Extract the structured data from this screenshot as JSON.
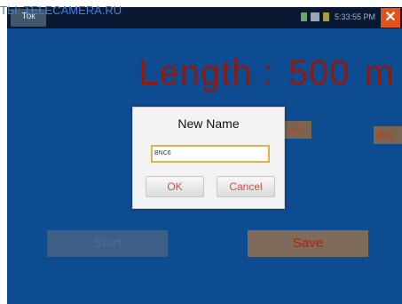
{
  "watermark": "ТЫ: TELECAMERA.RU",
  "topbar": {
    "back_label": "Ток",
    "time": "5:33:55 PM",
    "close_glyph": "✕"
  },
  "main": {
    "length_label": "Length :",
    "length_value": "500",
    "length_unit": "m",
    "btn_partial_1": "ed!",
    "btn_partial_2": "Bac",
    "left_button": "Start",
    "save_button": "Save"
  },
  "dialog": {
    "title": "New Name",
    "input_value": "BNC6",
    "ok_label": "OK",
    "cancel_label": "Cancel"
  },
  "colors": {
    "accent_red": "#8b1a10",
    "screen_blue": "#0e4c92",
    "close_orange": "#e0531b"
  }
}
